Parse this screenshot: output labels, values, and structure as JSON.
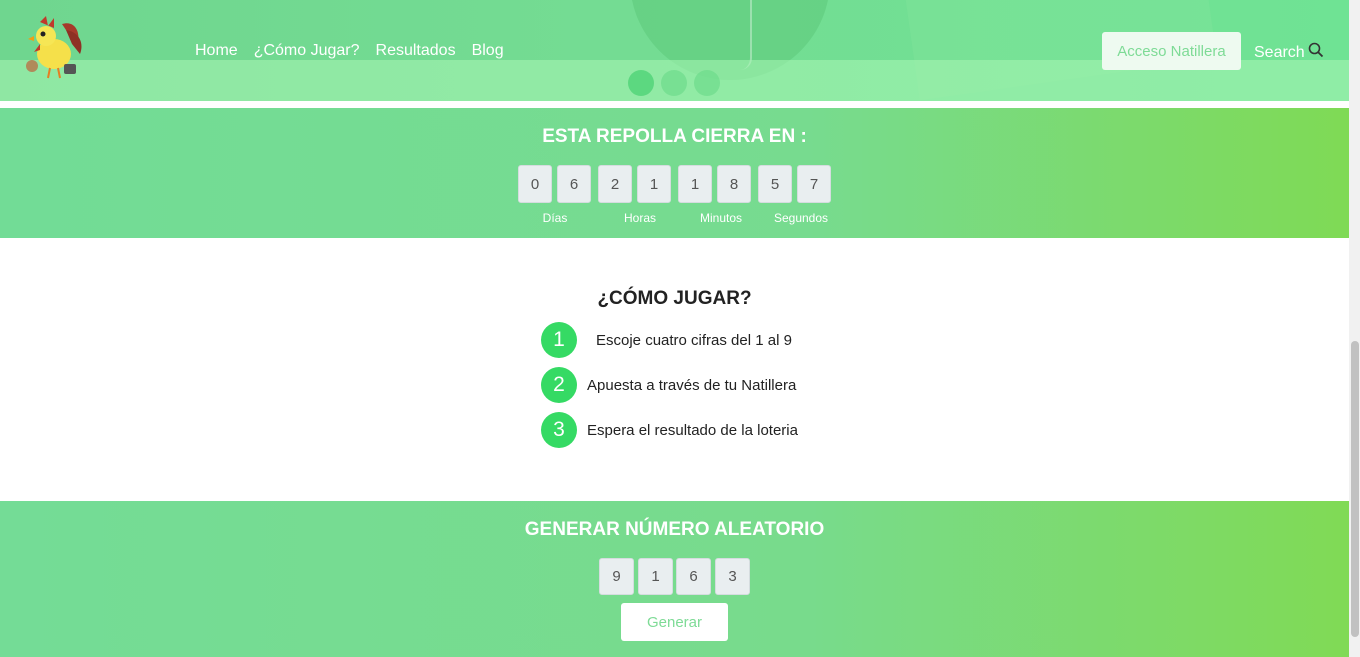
{
  "nav": {
    "items": [
      "Home",
      "¿Cómo Jugar?",
      "Resultados",
      "Blog"
    ],
    "access_label": "Acceso Natillera",
    "search_label": "Search"
  },
  "countdown": {
    "title": "ESTA REPOLLA CIERRA EN :",
    "digits": [
      "0",
      "6",
      "2",
      "1",
      "1",
      "8",
      "5",
      "7"
    ],
    "labels": [
      "Días",
      "Horas",
      "Minutos",
      "Segundos"
    ]
  },
  "howto": {
    "title": "¿CÓMO JUGAR?",
    "steps": [
      {
        "num": "1",
        "text": "Escoje cuatro cifras del 1 al 9"
      },
      {
        "num": "2",
        "text": "Apuesta a través de tu Natillera"
      },
      {
        "num": "3",
        "text": "Espera el resultado de la loteria"
      }
    ]
  },
  "generator": {
    "title": "GENERAR NÚMERO ALEATORIO",
    "digits": [
      "9",
      "1",
      "6",
      "3"
    ],
    "button_label": "Generar"
  },
  "colors": {
    "brand_green": "#35da64",
    "button_text": "#7edb96"
  }
}
